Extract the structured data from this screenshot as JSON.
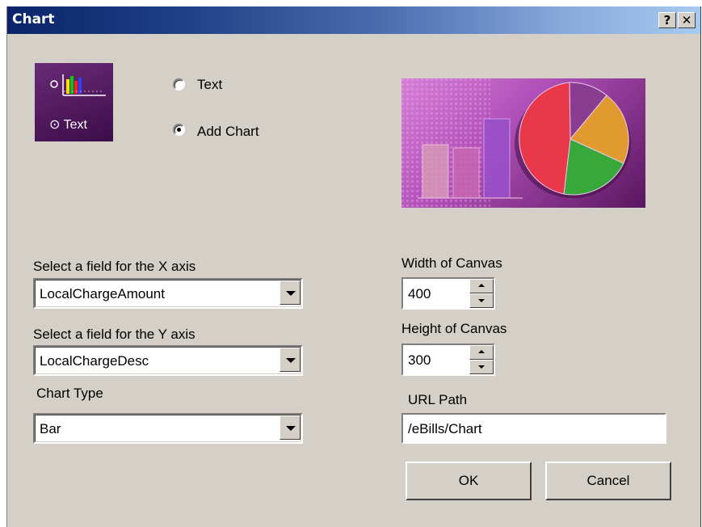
{
  "window": {
    "title": "Chart",
    "help_label": "?",
    "close_label": "✕"
  },
  "icon_tile": {
    "label": "⊙ Text",
    "icon": "bar-chart-icon"
  },
  "mode": {
    "options": [
      {
        "label": "Text",
        "selected": false
      },
      {
        "label": "Add Chart",
        "selected": true
      }
    ]
  },
  "preview": {
    "icon": "chart-preview-illustration"
  },
  "x_axis": {
    "label": "Select a field for the X axis",
    "value": "LocalChargeAmount"
  },
  "y_axis": {
    "label": "Select a field for the Y axis",
    "value": "LocalChargeDesc"
  },
  "chart_type": {
    "label": "Chart Type",
    "value": "Bar"
  },
  "canvas_width": {
    "label": "Width of Canvas",
    "value": "400"
  },
  "canvas_height": {
    "label": "Height of Canvas",
    "value": "300"
  },
  "url_path": {
    "label": "URL Path",
    "value": "/eBills/Chart"
  },
  "buttons": {
    "ok": "OK",
    "cancel": "Cancel"
  }
}
